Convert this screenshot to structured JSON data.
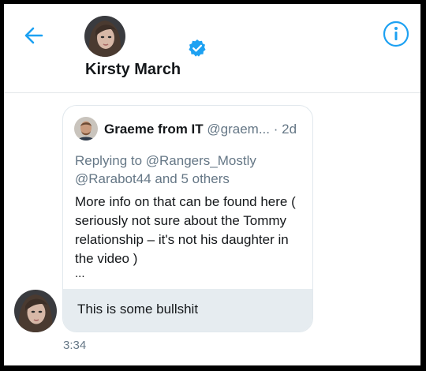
{
  "header": {
    "name": "Kirsty March",
    "back_icon": "back-arrow-icon",
    "info_icon": "info-icon",
    "verified_icon": "verified-badge-icon",
    "accent_color": "#1da1f2"
  },
  "quoted_tweet": {
    "author_name": "Graeme from IT",
    "author_handle": "@graem...",
    "time_ago": "· 2d",
    "replying_to": "Replying to @Rangers_Mostly @Rarabot44 and 5 others",
    "body": "More info on that can be found here ( seriously not sure about the Tommy relationship – it's not his daughter in the video )",
    "ellipsis": "..."
  },
  "message": {
    "text": "This is some bullshit",
    "timestamp": "3:34"
  }
}
